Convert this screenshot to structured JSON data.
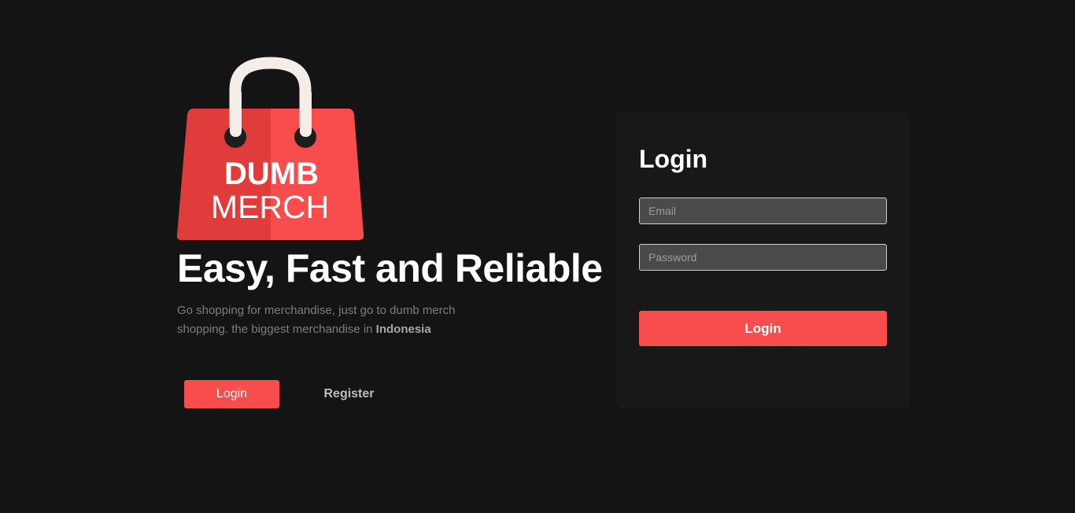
{
  "hero": {
    "logo": {
      "icon": "shopping-bag-logo",
      "line1": "DUMB",
      "line2": "MERCH",
      "bag_color": "#f74d4d",
      "bag_shade_color": "#e03c3c",
      "handle_color": "#f5ede8"
    },
    "headline": "Easy, Fast and Reliable",
    "tagline": "Go shopping for merchandise, just go to dumb merch shopping. the biggest merchandise in",
    "tagline_highlight": "Indonesia",
    "login_label": "Login",
    "register_label": "Register"
  },
  "login_form": {
    "title": "Login",
    "email_placeholder": "Email",
    "email_value": "",
    "password_placeholder": "Password",
    "password_value": "",
    "submit_label": "Login"
  },
  "colors": {
    "background": "#141414",
    "card": "#181818",
    "accent": "#f74d4d",
    "input_bg": "#4a4a4a"
  }
}
